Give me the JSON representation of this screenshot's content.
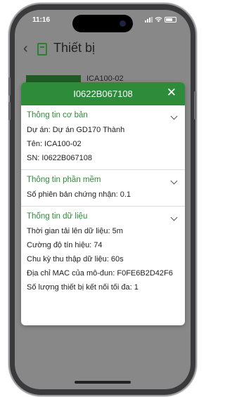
{
  "status_bar": {
    "time": "11:16"
  },
  "app_bar": {
    "back_glyph": "‹",
    "icon": "device-list-icon",
    "title": "Thiết bị"
  },
  "background_list": {
    "first_item_name": "ICA100-02"
  },
  "modal": {
    "title": "I0622B067108",
    "close_glyph": "✕",
    "sections": [
      {
        "title": "Thông tin cơ bản",
        "rows": [
          "Dự án: Dự án GD170 Thành",
          "Tên: ICA100-02",
          "SN: I0622B067108"
        ]
      },
      {
        "title": "Thông tin phần mềm",
        "rows": [
          "Số phiên bản chứng nhận: 0.1"
        ]
      },
      {
        "title": "Thống tin dữ liệu",
        "rows": [
          "Thời gian tải lên dữ liệu: 5m",
          "Cường độ tín hiệu: 74",
          "Chu kỳ thu thập dữ liệu: 60s",
          "Địa chỉ MAC của mô-đun: F0FE6B2D42F6",
          "Số lượng thiết bị kết nối tối đa: 1"
        ]
      }
    ]
  },
  "colors": {
    "accent": "#2e8b3a",
    "overlay": "#888888"
  }
}
